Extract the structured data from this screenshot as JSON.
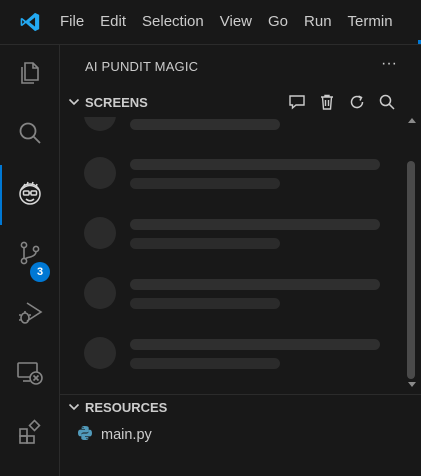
{
  "titlebar": {
    "menu": [
      "File",
      "Edit",
      "Selection",
      "View",
      "Go",
      "Run",
      "Termin"
    ]
  },
  "activitybar": {
    "items": [
      {
        "icon": "files-icon"
      },
      {
        "icon": "search-icon"
      },
      {
        "icon": "ai-pundit-magic-icon"
      },
      {
        "icon": "source-control-icon",
        "badge": "3"
      },
      {
        "icon": "run-debug-icon"
      },
      {
        "icon": "remote-explorer-icon"
      },
      {
        "icon": "extensions-icon"
      }
    ]
  },
  "sidebar": {
    "title": "AI PUNDIT MAGIC",
    "more_label": "···",
    "screens": {
      "title": "SCREENS",
      "actions": [
        "comment-icon",
        "trash-icon",
        "refresh-icon",
        "search-icon"
      ],
      "skeleton_rows": 5
    },
    "resources": {
      "title": "RESOURCES",
      "files": [
        {
          "name": "main.py",
          "icon": "python-file-icon"
        }
      ]
    }
  },
  "colors": {
    "background": "#181818",
    "accent": "#0078d4",
    "text": "#cccccc",
    "skeleton": "#2f2f2f",
    "python_icon": "#519aba"
  }
}
